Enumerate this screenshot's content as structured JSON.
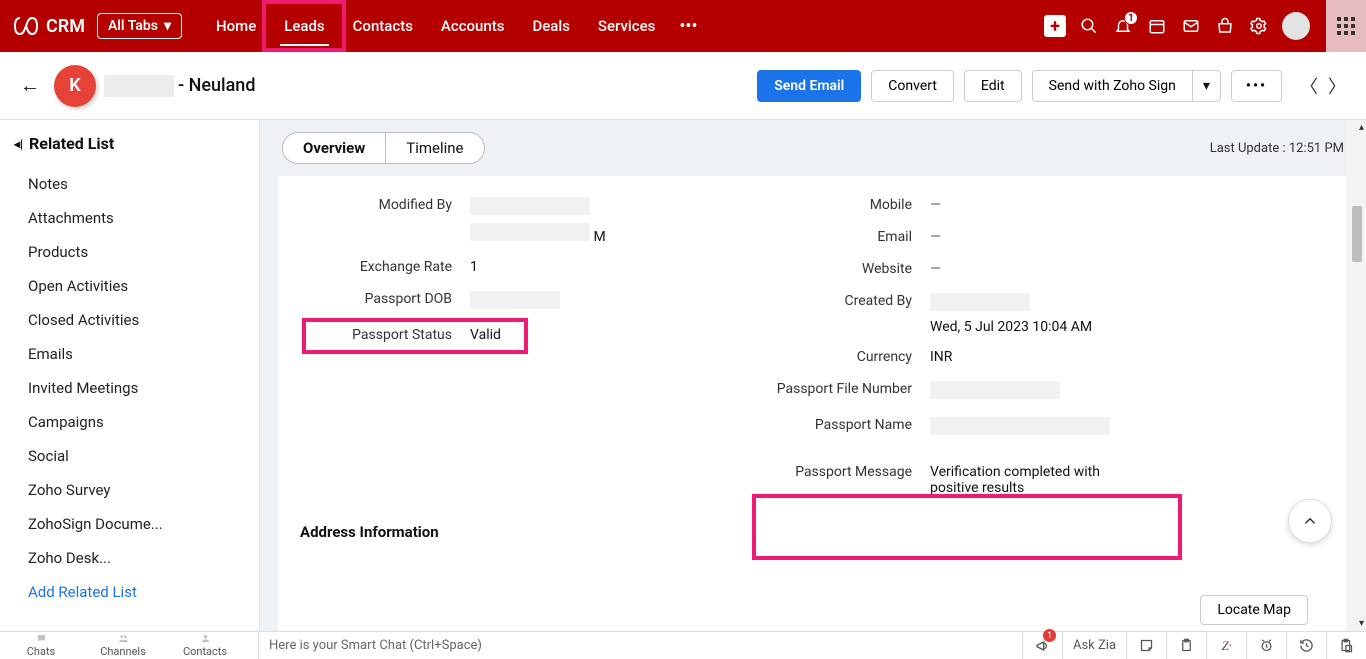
{
  "brand": "CRM",
  "alltabs_label": "All Tabs",
  "nav": [
    "Home",
    "Leads",
    "Contacts",
    "Accounts",
    "Deals",
    "Services"
  ],
  "nav_active_index": 1,
  "notif_badge": "1",
  "record": {
    "avatar_letter": "K",
    "name_suffix": "- Neuland"
  },
  "actions": {
    "send_email": "Send Email",
    "convert": "Convert",
    "edit": "Edit",
    "send_sign": "Send with Zoho Sign"
  },
  "sidebar": {
    "header": "Related List",
    "items": [
      "Notes",
      "Attachments",
      "Products",
      "Open Activities",
      "Closed Activities",
      "Emails",
      "Invited Meetings",
      "Campaigns",
      "Social",
      "Zoho Survey",
      "ZohoSign Docume...",
      "Zoho Desk..."
    ],
    "add_link": "Add Related List"
  },
  "tabs": {
    "overview": "Overview",
    "timeline": "Timeline"
  },
  "last_update_label": "Last Update :",
  "last_update_value": "12:51 PM",
  "left_fields": {
    "modified_by": {
      "label": "Modified By",
      "suffix": "M"
    },
    "exchange_rate": {
      "label": "Exchange Rate",
      "value": "1"
    },
    "passport_dob": {
      "label": "Passport DOB"
    },
    "passport_status": {
      "label": "Passport Status",
      "value": "Valid"
    }
  },
  "right_fields": {
    "mobile": {
      "label": "Mobile",
      "value": "—"
    },
    "email": {
      "label": "Email",
      "value": "—"
    },
    "website": {
      "label": "Website",
      "value": "—"
    },
    "created_by": {
      "label": "Created By",
      "meta": "Wed, 5 Jul 2023 10:04 AM"
    },
    "currency": {
      "label": "Currency",
      "value": "INR"
    },
    "passport_file": {
      "label": "Passport File Number"
    },
    "passport_name": {
      "label": "Passport Name"
    },
    "passport_msg": {
      "label": "Passport Message",
      "value": "Verification completed with positive results"
    }
  },
  "address_section": "Address Information",
  "locate_map": "Locate Map",
  "bottom": {
    "chats": "Chats",
    "channels": "Channels",
    "contacts": "Contacts",
    "smart_chat": "Here is your Smart Chat (Ctrl+Space)",
    "ask_zia": "Ask Zia",
    "badge": "1"
  }
}
